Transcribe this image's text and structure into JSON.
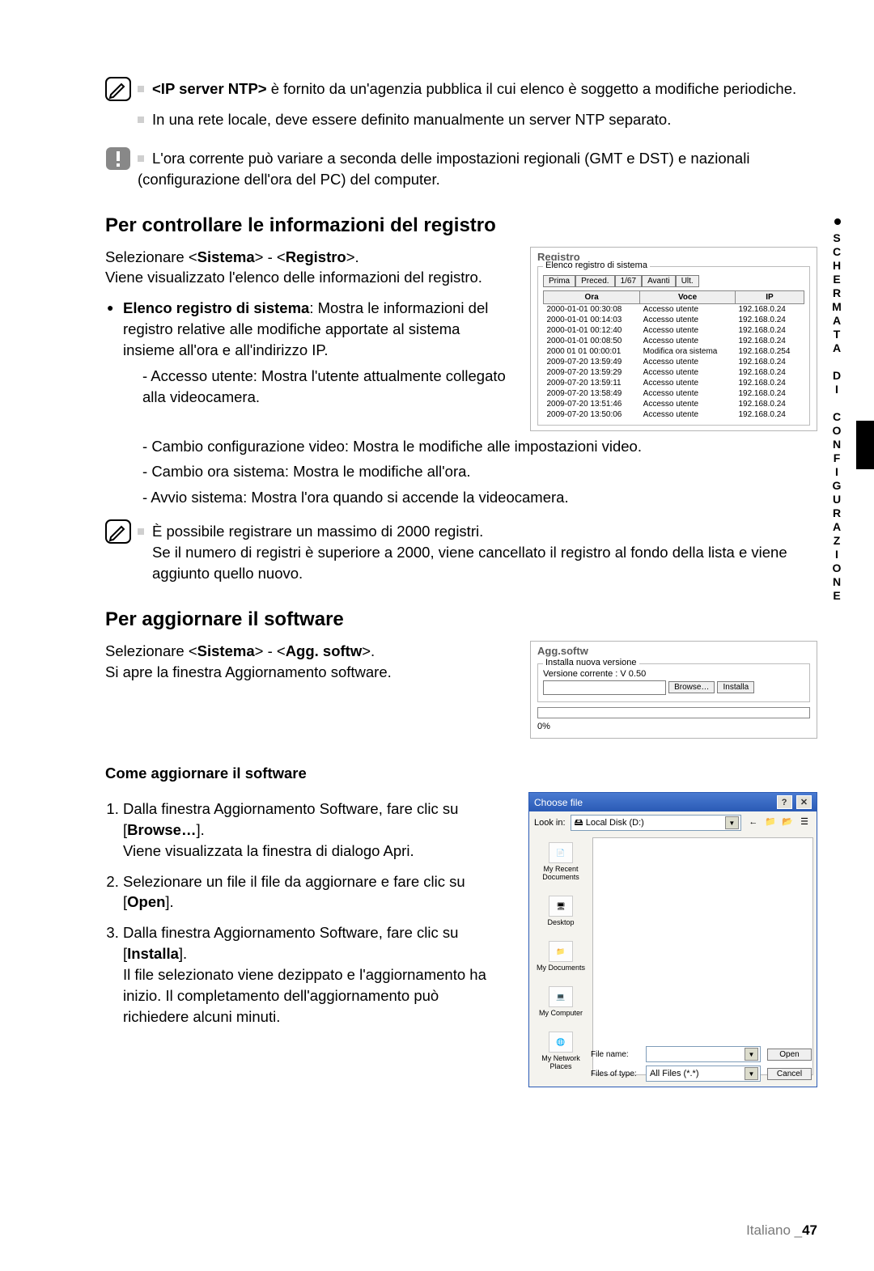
{
  "side_tab": "SCHERMATA DI CONFIGURAZIONE",
  "notes_top": [
    {
      "bold": "<IP server NTP>",
      "text": " è fornito da un'agenzia pubblica il cui elenco è soggetto a modifiche periodiche."
    },
    {
      "bold": "",
      "text": "In una rete locale, deve essere definito manualmente un server NTP separato."
    }
  ],
  "caution": "L'ora corrente può variare a seconda delle impostazioni regionali (GMT e DST) e nazionali (configurazione dell'ora del PC) del computer.",
  "sec1": {
    "heading": "Per controllare le informazioni del registro",
    "intro_pre": "Selezionare <",
    "b1": "Sistema",
    "intro_mid": "> - <",
    "b2": "Registro",
    "intro_post": ">.",
    "intro2": "Viene visualizzato l'elenco delle informazioni del registro.",
    "bullet_b": "Elenco registro di sistema",
    "bullet_text": ": Mostra le informazioni del registro relative alle modifiche apportate al sistema insieme all'ora e all'indirizzo IP.",
    "subs": [
      "Accesso utente: Mostra l'utente attualmente collegato alla videocamera.",
      "Cambio configurazione video: Mostra le modifiche alle impostazioni video.",
      "Cambio ora sistema: Mostra le modifiche all'ora.",
      "Avvio sistema: Mostra l'ora quando si accende la videocamera."
    ],
    "note1": "È possibile registrare un massimo di 2000 registri.",
    "note2": "Se il numero di registri è superiore a 2000, viene cancellato il registro al fondo della lista e viene aggiunto quello nuovo."
  },
  "registro": {
    "title": "Registro",
    "legend": "Elenco registro di sistema",
    "buttons": [
      "Prima",
      "Preced.",
      "1/67",
      "Avanti",
      "Ult."
    ],
    "headers": [
      "Ora",
      "Voce",
      "IP"
    ],
    "rows": [
      [
        "2000-01-01 00:30:08",
        "Accesso utente",
        "192.168.0.24"
      ],
      [
        "2000-01-01 00:14:03",
        "Accesso utente",
        "192.168.0.24"
      ],
      [
        "2000-01-01 00:12:40",
        "Accesso utente",
        "192.168.0.24"
      ],
      [
        "2000-01-01 00:08:50",
        "Accesso utente",
        "192.168.0.24"
      ],
      [
        "2000 01 01 00:00:01",
        "Modifica ora sistema",
        "192.168.0.254"
      ],
      [
        "2009-07-20 13:59:49",
        "Accesso utente",
        "192.168.0.24"
      ],
      [
        "2009-07-20 13:59:29",
        "Accesso utente",
        "192.168.0.24"
      ],
      [
        "2009-07-20 13:59:11",
        "Accesso utente",
        "192.168.0.24"
      ],
      [
        "2009-07-20 13:58:49",
        "Accesso utente",
        "192.168.0.24"
      ],
      [
        "2009-07-20 13:51:46",
        "Accesso utente",
        "192.168.0.24"
      ],
      [
        "2009-07-20 13:50:06",
        "Accesso utente",
        "192.168.0.24"
      ]
    ]
  },
  "sec2": {
    "heading": "Per aggiornare il software",
    "intro_pre": "Selezionare <",
    "b1": "Sistema",
    "intro_mid": "> - <",
    "b2": "Agg. softw",
    "intro_post": ">.",
    "intro2": "Si apre la finestra Aggiornamento software.",
    "subheading": "Come aggiornare il software",
    "steps": [
      {
        "pre": "Dalla finestra Aggiornamento Software, fare clic su [",
        "b": "Browse…",
        "post": "].",
        "after": "Viene visualizzata la finestra di dialogo Apri."
      },
      {
        "pre": "Selezionare un file il file da aggiornare e fare clic su [",
        "b": "Open",
        "post": "].",
        "after": ""
      },
      {
        "pre": "Dalla finestra Aggiornamento Software, fare clic su [",
        "b": "Installa",
        "post": "].",
        "after": "Il file selezionato viene dezippato e l'aggiornamento ha inizio. Il completamento dell'aggiornamento può richiedere alcuni minuti."
      }
    ]
  },
  "agg": {
    "title": "Agg.softw",
    "legend": "Installa nuova versione",
    "version": "Versione corrente : V 0.50",
    "browse": "Browse…",
    "install": "Installa",
    "pct": "0%"
  },
  "filedlg": {
    "title": "Choose file",
    "lookin_lbl": "Look in:",
    "lookin_val": "Local Disk (D:)",
    "side": [
      "My Recent Documents",
      "Desktop",
      "My Documents",
      "My Computer",
      "My Network Places"
    ],
    "filename_lbl": "File name:",
    "filename_val": "",
    "filetype_lbl": "Files of type:",
    "filetype_val": "All Files (*.*)",
    "open": "Open",
    "cancel": "Cancel"
  },
  "footer": {
    "lang": "Italiano _",
    "num": "47"
  }
}
